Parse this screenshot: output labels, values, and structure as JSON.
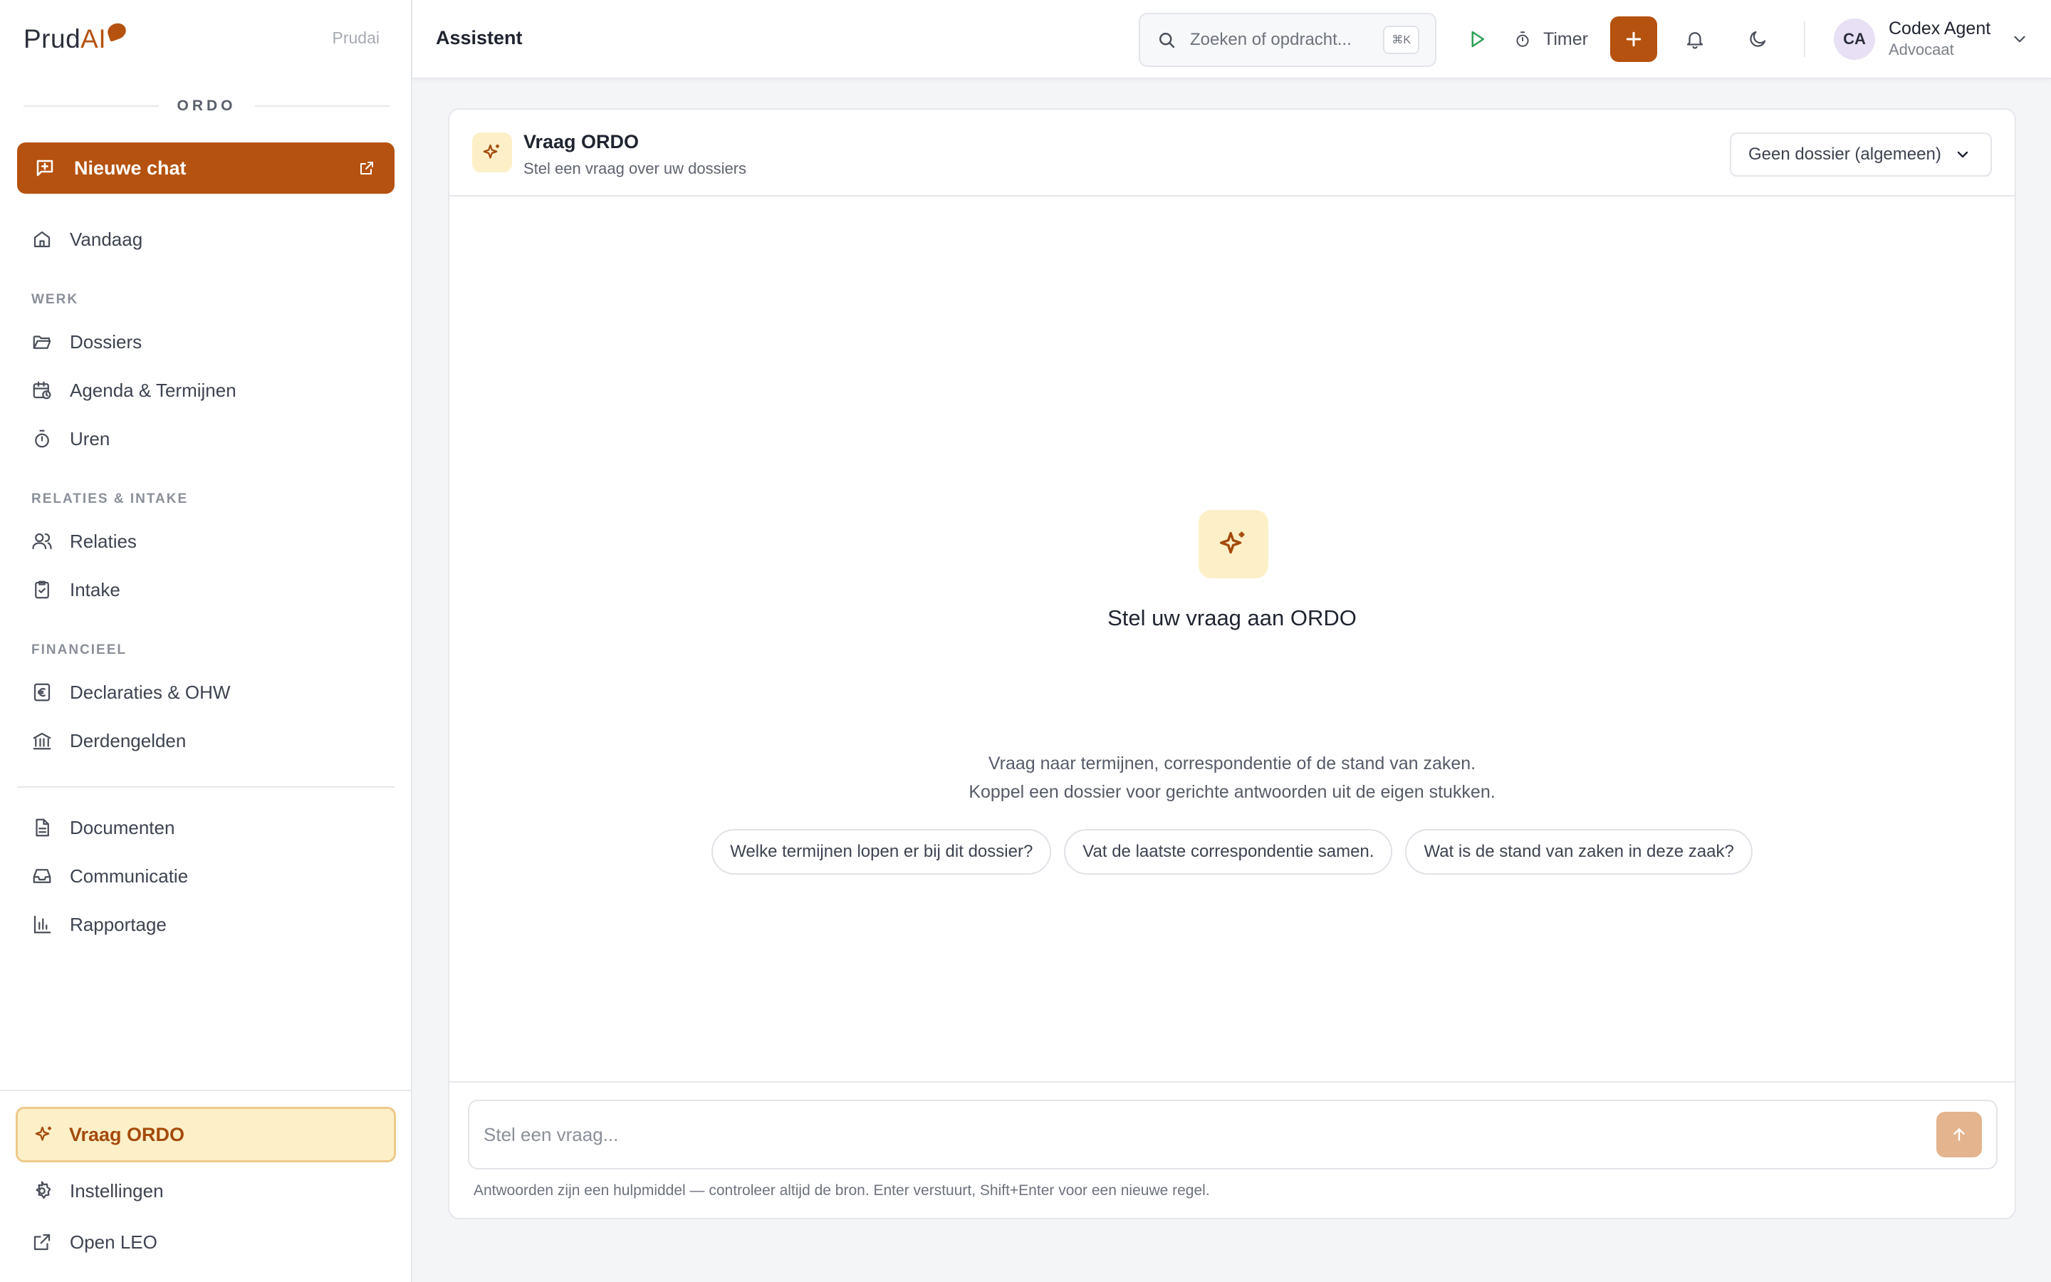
{
  "brand": {
    "name_main": "Prud",
    "name_accent": "AI",
    "tag": "Prudai"
  },
  "sidebar": {
    "section_title": "ORDO",
    "new_chat_label": "Nieuwe chat",
    "today_label": "Vandaag",
    "sections": {
      "werk": "WERK",
      "relaties": "RELATIES & INTAKE",
      "financieel": "FINANCIEEL"
    },
    "items": {
      "dossiers": "Dossiers",
      "agenda": "Agenda & Termijnen",
      "uren": "Uren",
      "relaties": "Relaties",
      "intake": "Intake",
      "declaraties": "Declaraties & OHW",
      "derdengelden": "Derdengelden",
      "documenten": "Documenten",
      "communicatie": "Communicatie",
      "rapportage": "Rapportage"
    },
    "bottom": {
      "vraag_ordo": "Vraag ORDO",
      "instellingen": "Instellingen",
      "open_leo": "Open LEO"
    }
  },
  "topbar": {
    "title": "Assistent",
    "search_placeholder": "Zoeken of opdracht...",
    "search_shortcut": "⌘K",
    "timer_label": "Timer",
    "user": {
      "initials": "CA",
      "name": "Codex Agent",
      "role": "Advocaat"
    }
  },
  "card": {
    "title": "Vraag ORDO",
    "subtitle": "Stel een vraag over uw dossiers",
    "dossier_select": "Geen dossier (algemeen)",
    "empty": {
      "title": "Stel uw vraag aan ORDO",
      "line1": "Vraag naar termijnen, correspondentie of de stand van zaken.",
      "line2": "Koppel een dossier voor gerichte antwoorden uit de eigen stukken."
    },
    "suggestions": [
      "Welke termijnen lopen er bij dit dossier?",
      "Vat de laatste correspondentie samen.",
      "Wat is de stand van zaken in deze zaak?"
    ],
    "composer_placeholder": "Stel een vraag...",
    "disclaimer": "Antwoorden zijn een hulpmiddel — controleer altijd de bron. Enter verstuurt, Shift+Enter voor een nieuwe regel."
  },
  "colors": {
    "accent": "#b5520f",
    "accent_soft": "#fdf0c8",
    "play_green": "#2f9e55"
  }
}
